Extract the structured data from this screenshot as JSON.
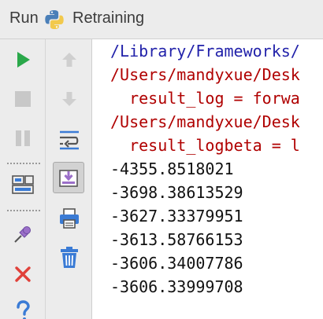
{
  "titlebar": {
    "run_label": "Run",
    "config_name": "Retraining",
    "icon": "python-icon"
  },
  "toolbar_left": {
    "items": [
      {
        "name": "rerun-icon",
        "state": "enabled",
        "color": "#2aa84a"
      },
      {
        "name": "stop-icon",
        "state": "disabled"
      },
      {
        "name": "pause-icon",
        "state": "disabled"
      },
      {
        "name": "layout-icon",
        "state": "enabled"
      },
      {
        "name": "pin-icon",
        "state": "enabled"
      },
      {
        "name": "close-icon",
        "state": "enabled",
        "color": "#e0413a"
      },
      {
        "name": "help-icon",
        "state": "enabled"
      }
    ]
  },
  "toolbar_right": {
    "items": [
      {
        "name": "up-arrow-icon",
        "state": "disabled"
      },
      {
        "name": "down-arrow-icon",
        "state": "disabled"
      },
      {
        "name": "soft-wrap-icon",
        "state": "enabled"
      },
      {
        "name": "scroll-to-end-icon",
        "state": "pressed"
      },
      {
        "name": "print-icon",
        "state": "enabled"
      },
      {
        "name": "trash-icon",
        "state": "enabled"
      }
    ]
  },
  "console": {
    "lines": [
      {
        "text": "/Library/Frameworks/",
        "style": "blue"
      },
      {
        "text": "/Users/mandyxue/Desk",
        "style": "red"
      },
      {
        "text": "  result_log = forwa",
        "style": "red"
      },
      {
        "text": "/Users/mandyxue/Desk",
        "style": "red"
      },
      {
        "text": "  result_logbeta = l",
        "style": "red"
      },
      {
        "text": "-4355.8518021",
        "style": "black"
      },
      {
        "text": "-3698.38613529",
        "style": "black"
      },
      {
        "text": "-3627.33379951",
        "style": "black"
      },
      {
        "text": "-3613.58766153",
        "style": "black"
      },
      {
        "text": "-3606.34007786",
        "style": "black"
      },
      {
        "text": "-3606.33999708",
        "style": "black"
      }
    ]
  },
  "colors": {
    "stdout_path": "#2222aa",
    "stderr": "#b00000",
    "output": "#111111",
    "run_green": "#2aa84a",
    "close_red": "#e0413a",
    "tool_blue": "#3a7bd5"
  }
}
